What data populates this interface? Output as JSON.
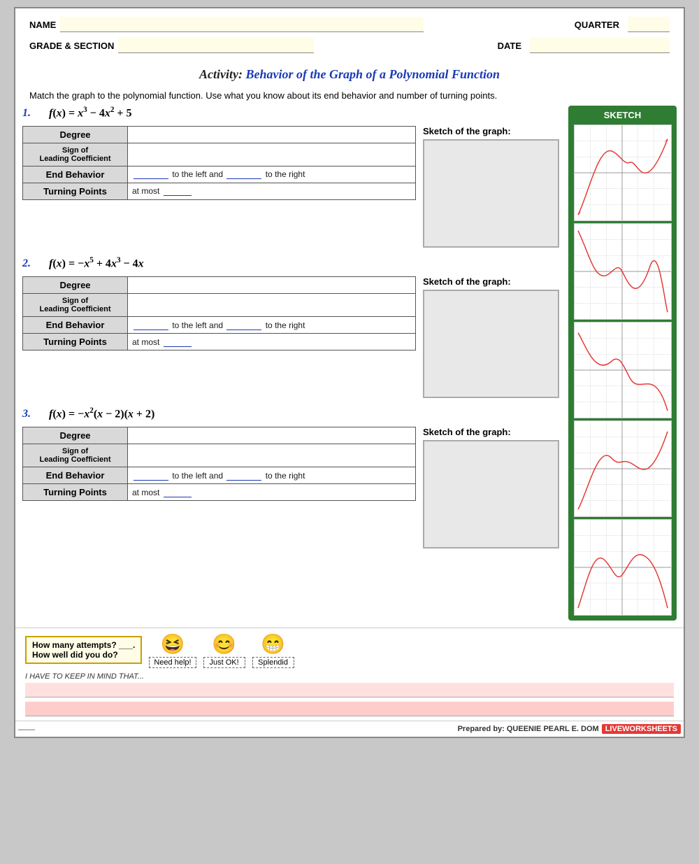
{
  "header": {
    "name_label": "NAME",
    "name_value": "",
    "quarter_label": "QUARTER",
    "quarter_value": "",
    "grade_label": "GRADE & SECTION",
    "grade_value": "",
    "date_label": "DATE",
    "date_value": ""
  },
  "title": {
    "prefix": "Activity: ",
    "main": "Behavior of the Graph of a Polynomial Function"
  },
  "instructions": "Match the graph to the polynomial function. Use what you know about its end behavior and number of turning points.",
  "sketch_sidebar_label": "SKETCH",
  "problems": [
    {
      "number": "1.",
      "formula": "f(x) = x³ − 4x² + 5",
      "degree_label": "Degree",
      "degree_value": "",
      "sign_label": "Sign of Leading Coefficient",
      "sign_value": "",
      "end_behavior_label": "End Behavior",
      "end_behavior_value": "_____ to the left and _____ to the right",
      "turning_label": "Turning Points",
      "turning_value": "at most _____",
      "sketch_label": "Sketch of the graph:"
    },
    {
      "number": "2.",
      "formula": "f(x) = −x⁵ + 4x³ − 4x",
      "degree_label": "Degree",
      "degree_value": "",
      "sign_label": "Sign of Leading Coefficient",
      "sign_value": "",
      "end_behavior_label": "End Behavior",
      "end_behavior_value": "_____ to the left and _____ to the right",
      "turning_label": "Turning Points",
      "turning_value": "at most _____",
      "sketch_label": "Sketch of the graph:"
    },
    {
      "number": "3.",
      "formula": "f(x) = −x²(x − 2)(x + 2)",
      "degree_label": "Degree",
      "degree_value": "",
      "sign_label": "Sign of Leading Coefficient",
      "sign_value": "",
      "end_behavior_label": "End Behavior",
      "end_behavior_value": "_____ to the left and _____ to the right",
      "turning_label": "Turning Points",
      "turning_value": "at most _____",
      "sketch_label": "Sketch of the graph:"
    }
  ],
  "footer": {
    "attempts_line1": "How many attempts? ___.",
    "attempts_line2": "How well did you do?",
    "emoji1": "😆",
    "emoji1_label": "Need help!",
    "emoji2": "😊",
    "emoji2_label": "Just OK!",
    "emoji3": "😁",
    "emoji3_label": "Splendid",
    "reminder_label": "I HAVE TO KEEP IN MIND THAT...",
    "reminder_value": ""
  },
  "bottom": {
    "prepared_by": "Prepared by: QUEENIE PEARL E. DOM",
    "badge": "LIVEWORKSHEETS"
  }
}
